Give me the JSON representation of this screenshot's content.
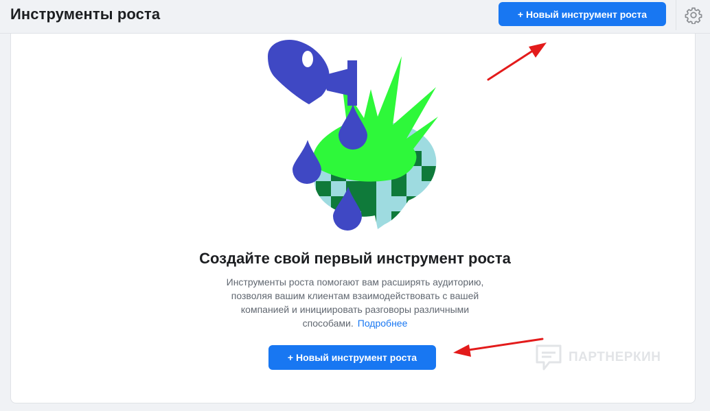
{
  "header": {
    "title": "Инструменты роста",
    "new_button_label": "+ Новый инструмент роста",
    "settings_icon": "gear-icon"
  },
  "empty_state": {
    "illustration": "watering-can-plant-illustration",
    "title": "Создайте свой первый инструмент роста",
    "description": "Инструменты роста помогают вам расширять аудиторию, позволяя вашим клиентам взаимодействовать с вашей компанией и инициировать разговоры различными способами.",
    "learn_more": "Подробнее",
    "button_label": "+ Новый инструмент роста"
  },
  "watermark": {
    "text": "ПАРТНЕРКИН"
  },
  "colors": {
    "primary": "#1877f2",
    "annotation_arrow": "#e31b1b",
    "can": "#3f48c4",
    "leaves": "#2ef83a",
    "pot_dark": "#0f7a3a",
    "pot_light": "#9edbe0"
  }
}
